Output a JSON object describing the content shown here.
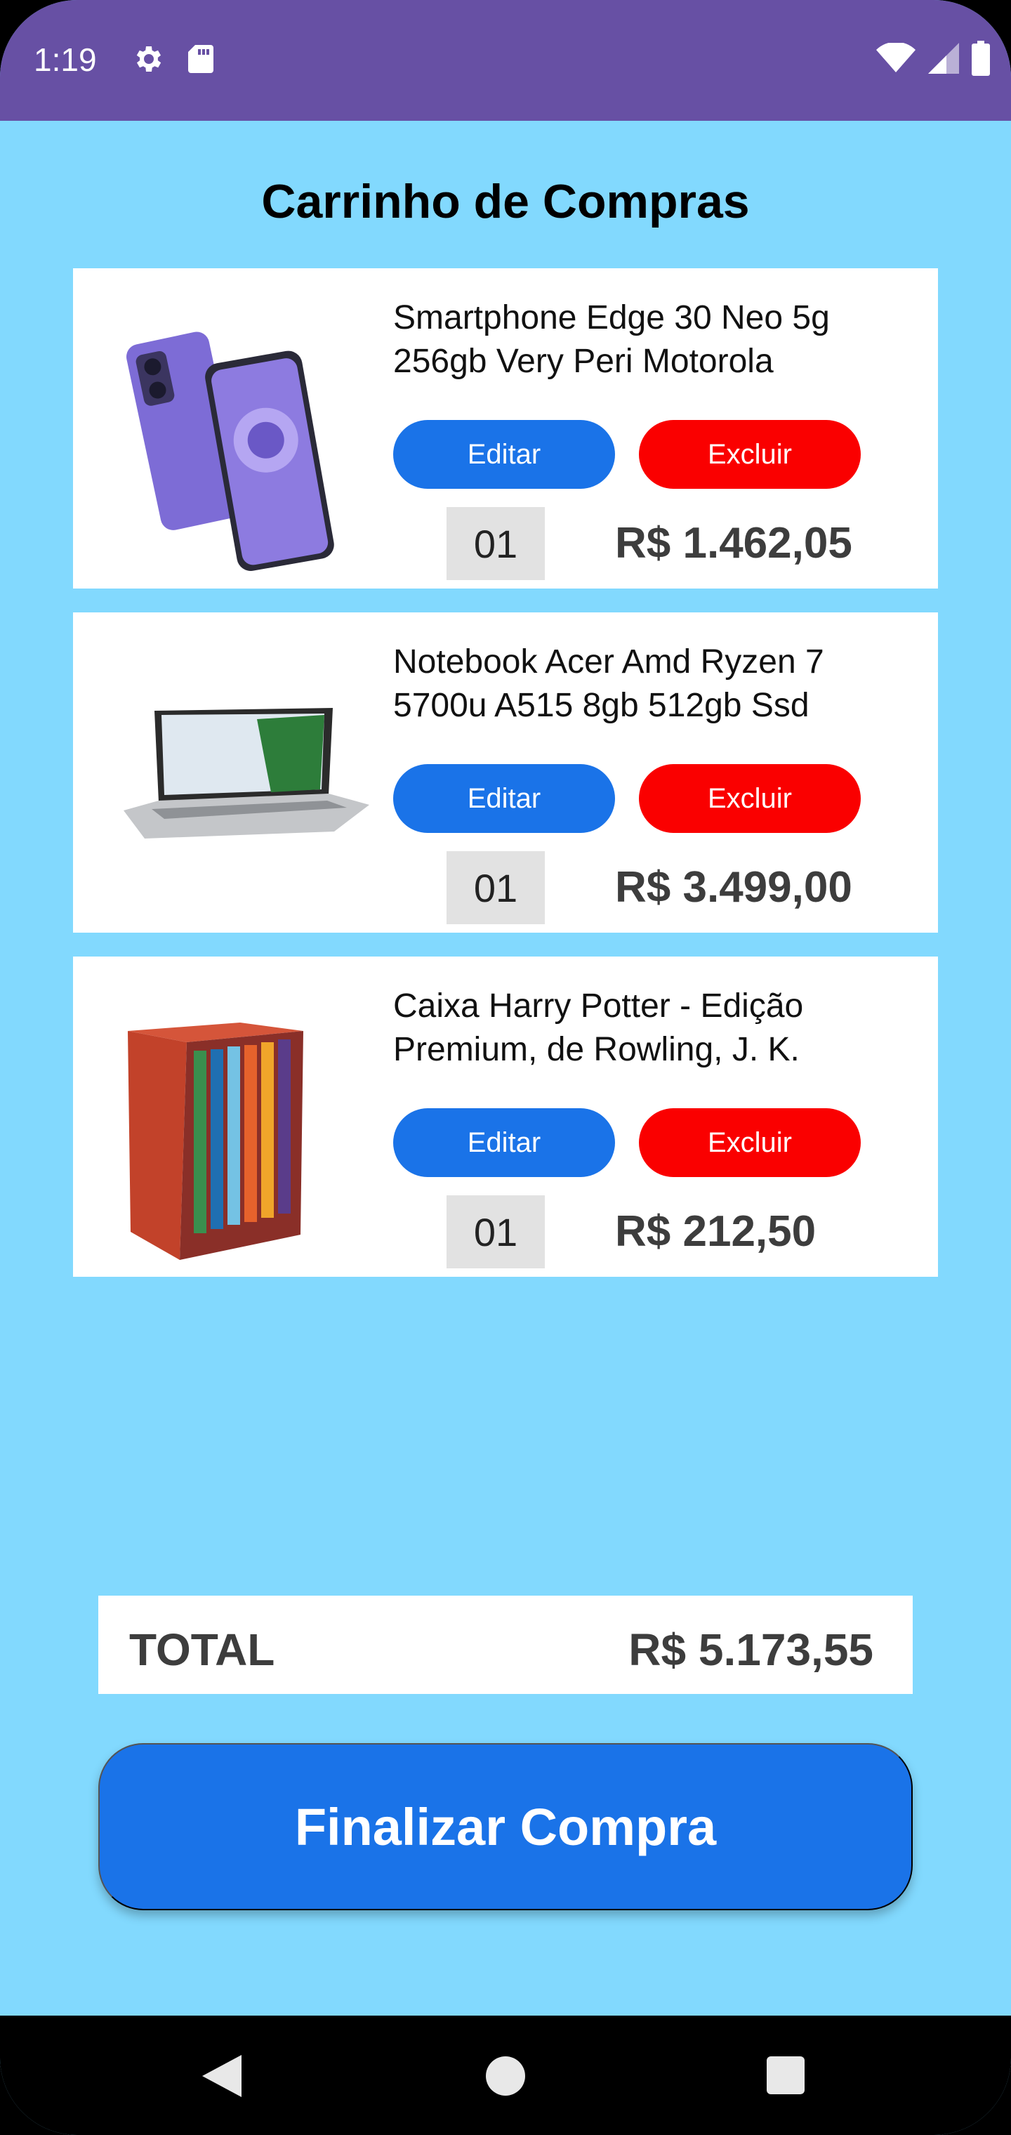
{
  "status_bar": {
    "time": "1:19",
    "icons": [
      "gear-icon",
      "sd-card-icon",
      "wifi-icon",
      "signal-icon",
      "battery-icon"
    ]
  },
  "page": {
    "title": "Carrinho de Compras"
  },
  "colors": {
    "status_bar": "#6750a4",
    "background": "#82d9fe",
    "edit": "#1a73e8",
    "delete": "#fa0000",
    "checkout": "#1a73e8"
  },
  "cart": {
    "items": [
      {
        "name": "Smartphone Edge 30 Neo 5g 256gb Very Peri Motorola",
        "edit_label": "Editar",
        "delete_label": "Excluir",
        "quantity": "01",
        "price": "R$ 1.462,05"
      },
      {
        "name": "Notebook Acer Amd Ryzen 7 5700u A515 8gb 512gb Ssd",
        "edit_label": "Editar",
        "delete_label": "Excluir",
        "quantity": "01",
        "price": "R$ 3.499,00"
      },
      {
        "name": "Caixa Harry Potter - Edição Premium, de Rowling, J. K.",
        "edit_label": "Editar",
        "delete_label": "Excluir",
        "quantity": "01",
        "price": "R$ 212,50"
      }
    ]
  },
  "summary": {
    "total_label": "TOTAL",
    "total_value": "R$ 5.173,55"
  },
  "checkout": {
    "label": "Finalizar Compra"
  },
  "nav": {
    "icons": [
      "back-icon",
      "home-icon",
      "recents-icon"
    ]
  }
}
